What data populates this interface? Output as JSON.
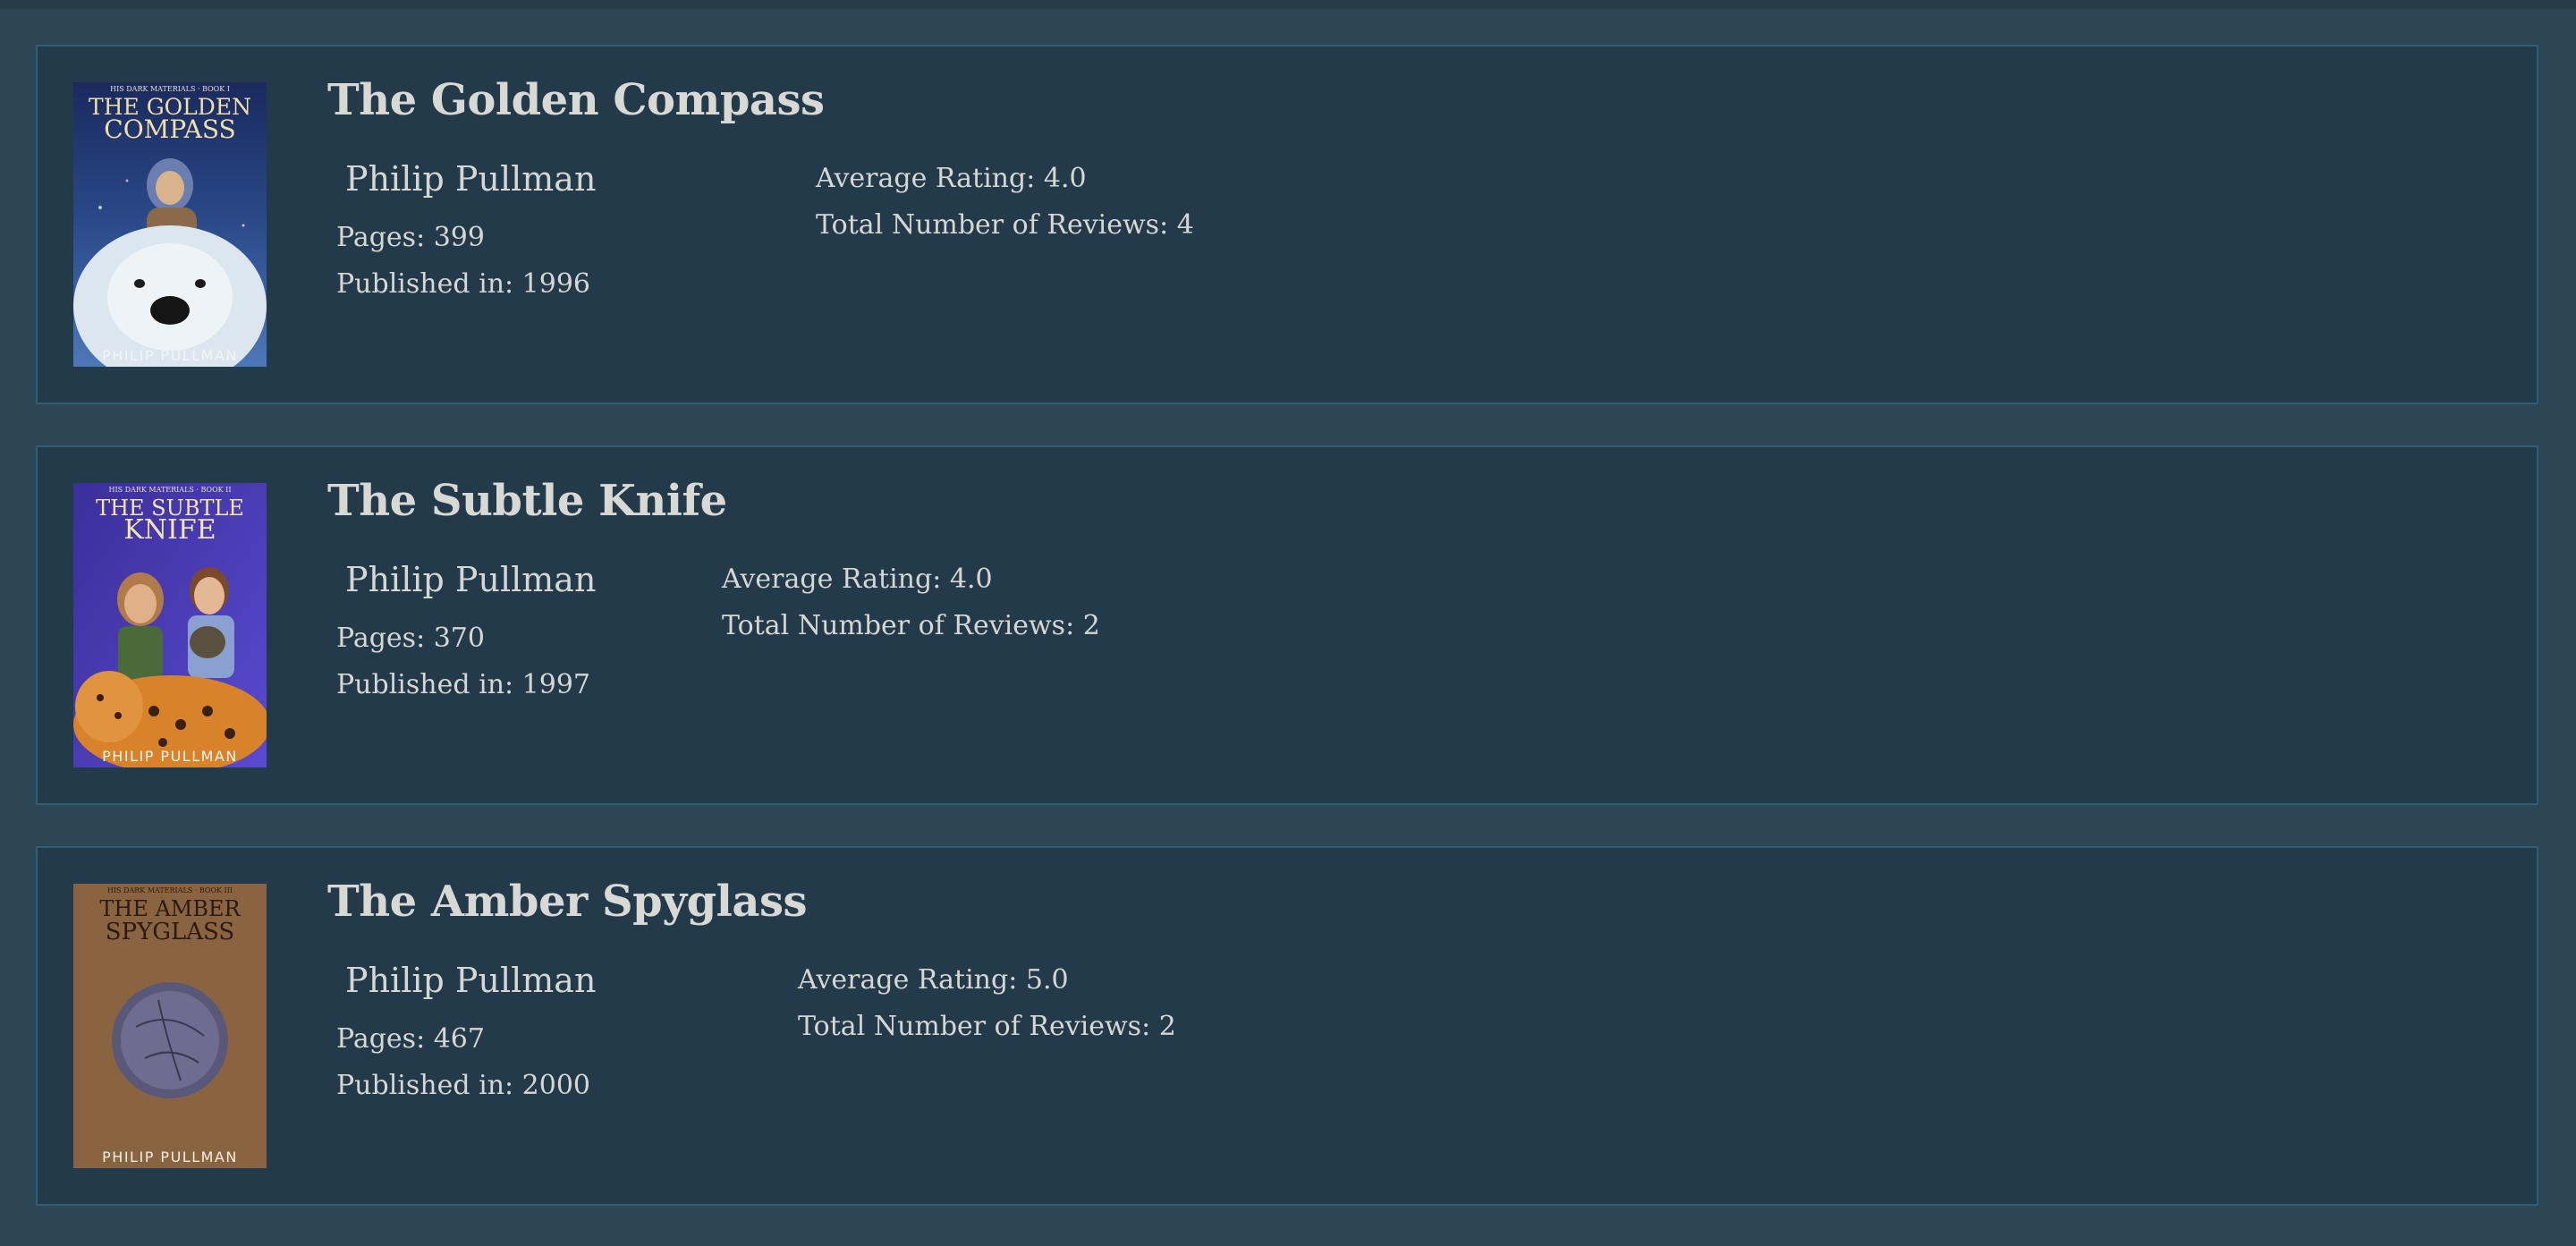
{
  "colors": {
    "page_background": "#2c4655",
    "card_background": "#233a4a",
    "card_border": "#2d6076",
    "text": "#d6d6d2"
  },
  "books": [
    {
      "title": "The Golden Compass",
      "author": "Philip Pullman",
      "pages": "Pages: 399",
      "published": "Published in: 1996",
      "rating": "Average Rating: 4.0",
      "reviews": "Total Number of Reviews: 4",
      "cover": {
        "series": "HIS DARK MATERIALS · BOOK I",
        "title_line1": "THE GOLDEN",
        "title_line2": "COMPASS",
        "author": "PHILIP PULLMAN"
      }
    },
    {
      "title": "The Subtle Knife",
      "author": "Philip Pullman",
      "pages": "Pages: 370",
      "published": "Published in: 1997",
      "rating": "Average Rating: 4.0",
      "reviews": "Total Number of Reviews: 2",
      "cover": {
        "series": "HIS DARK MATERIALS · BOOK II",
        "title_line1": "THE SUBTLE",
        "title_line2": "KNIFE",
        "author": "PHILIP PULLMAN"
      }
    },
    {
      "title": "The Amber Spyglass",
      "author": "Philip Pullman",
      "pages": "Pages: 467",
      "published": "Published in: 2000",
      "rating": "Average Rating: 5.0",
      "reviews": "Total Number of Reviews: 2",
      "cover": {
        "series": "HIS DARK MATERIALS · BOOK III",
        "title_line1": "THE AMBER",
        "title_line2": "SPYGLASS",
        "author": "PHILIP PULLMAN"
      }
    }
  ]
}
